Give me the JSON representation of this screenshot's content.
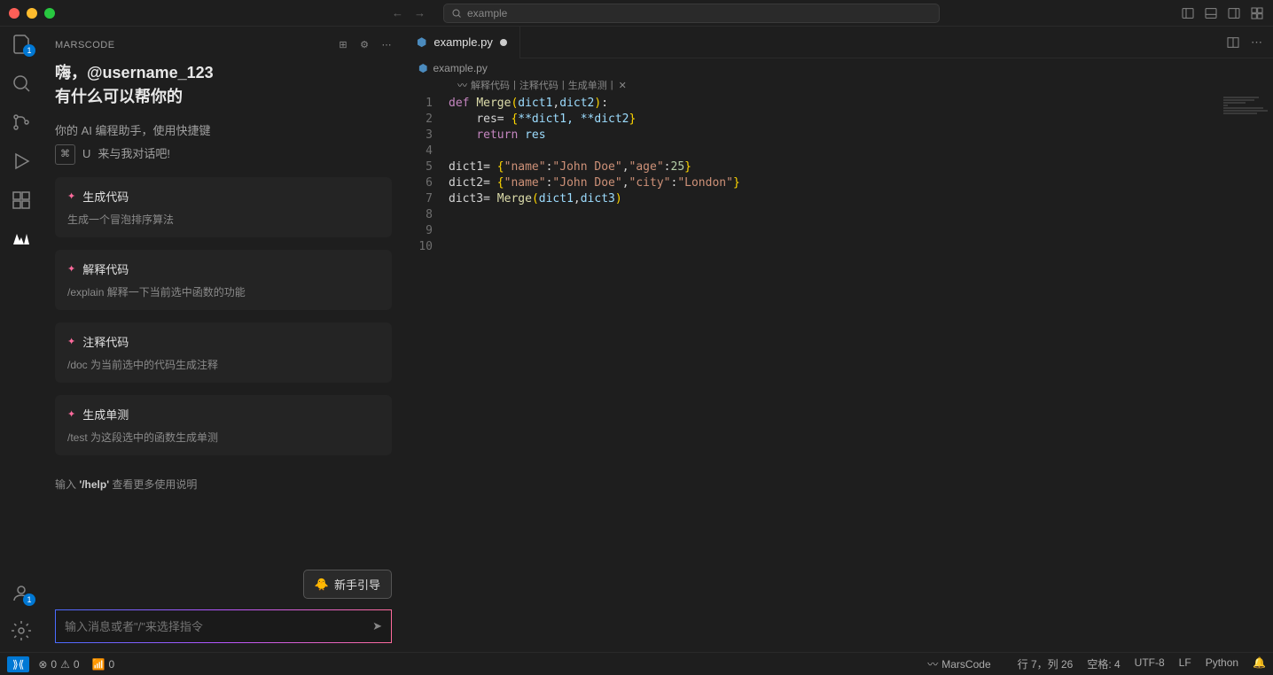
{
  "search": {
    "placeholder": "example",
    "icon": "search-icon"
  },
  "sidebar": {
    "title": "MARSCODE",
    "greeting_line1": "嗨，@username_123",
    "greeting_line2": "有什么可以帮你的",
    "subtext": "你的 AI 编程助手，使用快捷键",
    "kbd1": "⌘",
    "kbd2": "U",
    "kbd_tail": "来与我对话吧!",
    "cards": [
      {
        "title": "生成代码",
        "desc": "生成一个冒泡排序算法"
      },
      {
        "title": "解释代码",
        "desc": "/explain 解释一下当前选中函数的功能"
      },
      {
        "title": "注释代码",
        "desc": "/doc 为当前选中的代码生成注释"
      },
      {
        "title": "生成单测",
        "desc": "/test 为这段选中的函数生成单测"
      }
    ],
    "help_prefix": "输入 ",
    "help_cmd": "'/help'",
    "help_suffix": " 查看更多使用说明",
    "guide_btn": "新手引导",
    "input_placeholder": "输入消息或者\"/\"来选择指令"
  },
  "activity_badges": {
    "explorer": "1",
    "accounts": "1"
  },
  "tab": {
    "filename": "example.py"
  },
  "breadcrumb": {
    "file": "example.py"
  },
  "code_actions": {
    "a1": "解释代码",
    "a2": "注释代码",
    "a3": "生成单测",
    "sep": " | "
  },
  "code": {
    "lines": [
      "1",
      "2",
      "3",
      "4",
      "5",
      "6",
      "7",
      "8",
      "9",
      "10"
    ],
    "tokens": {
      "def": "def ",
      "fn_merge": "Merge",
      "lp": "(",
      "rp": ")",
      "dict1": "dict1",
      "dict2": "dict2",
      "dict3": "dict3",
      "comma": ",",
      "colon": ":",
      "indent": "    ",
      "res_assign": "res= ",
      "lbrace": "{",
      "rbrace": "}",
      "spread1": "**dict1, **dict2",
      "return": "return ",
      "res": "res",
      "d1_assign": "dict1= ",
      "d2_assign": "dict2= ",
      "d3_assign": "dict3= ",
      "name_k": "\"name\"",
      "john": "\"John Doe\"",
      "age_k": "\"age\"",
      "age_v": "25",
      "city_k": "\"city\"",
      "city_v": "\"London\""
    }
  },
  "status": {
    "errors": "0",
    "warnings": "0",
    "ports": "0",
    "marscode": "MarsCode",
    "cursor": "行 7，列 26",
    "spaces": "空格: 4",
    "encoding": "UTF-8",
    "eol": "LF",
    "lang": "Python"
  }
}
